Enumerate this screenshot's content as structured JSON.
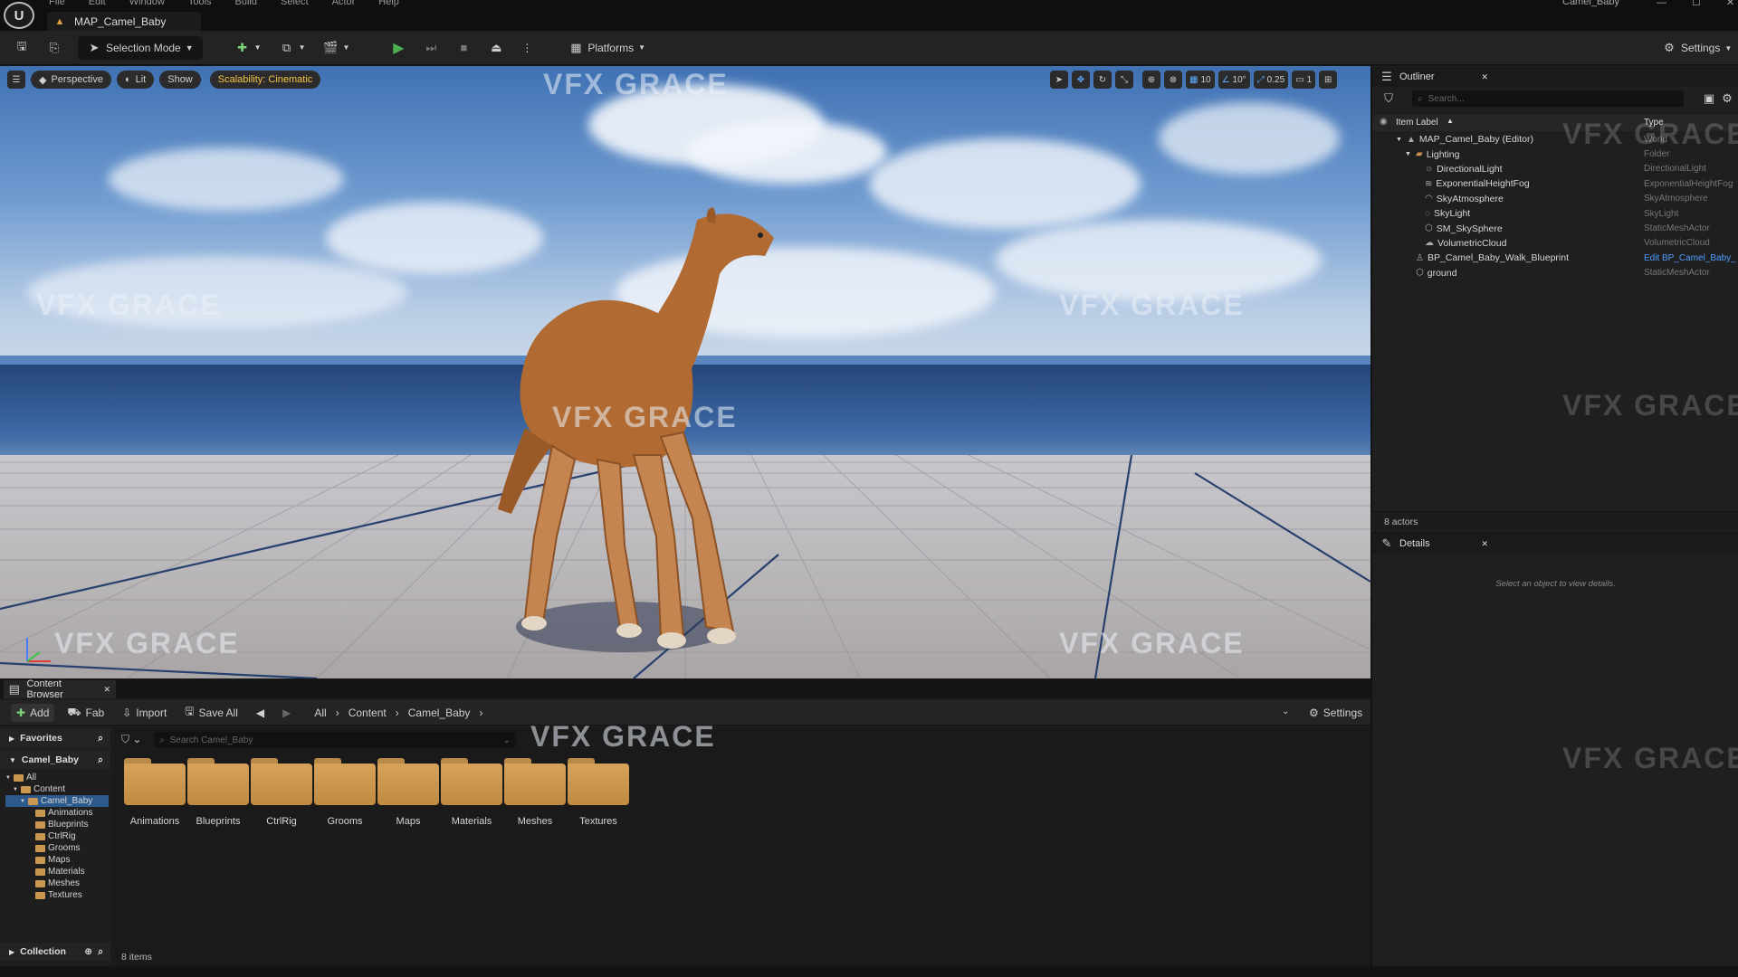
{
  "menubar": {
    "menus": [
      "File",
      "Edit",
      "Window",
      "Tools",
      "Build",
      "Select",
      "Actor",
      "Help"
    ],
    "map_tab": "MAP_Camel_Baby",
    "project": "Camel_Baby"
  },
  "toolbar": {
    "selection_mode": "Selection Mode",
    "platforms": "Platforms",
    "settings": "Settings"
  },
  "viewport": {
    "perspective": "Perspective",
    "lit": "Lit",
    "show": "Show",
    "scalability": "Scalability: Cinematic",
    "grid": "10",
    "angle": "10°",
    "scale": "0.25",
    "camera": "1"
  },
  "watermark": "VFX GRACE",
  "outliner": {
    "tab": "Outliner",
    "search_placeholder": "Search...",
    "col_label": "Item Label",
    "col_type": "Type",
    "rows": [
      {
        "label": "MAP_Camel_Baby (Editor)",
        "type": "World",
        "indent": 0,
        "icon": "map-icon"
      },
      {
        "label": "Lighting",
        "type": "Folder",
        "indent": 1,
        "icon": "folder-icon"
      },
      {
        "label": "DirectionalLight",
        "type": "DirectionalLight",
        "indent": 2,
        "icon": "sun-icon"
      },
      {
        "label": "ExponentialHeightFog",
        "type": "ExponentialHeightFog",
        "indent": 2,
        "icon": "fog-icon"
      },
      {
        "label": "SkyAtmosphere",
        "type": "SkyAtmosphere",
        "indent": 2,
        "icon": "atmosphere-icon"
      },
      {
        "label": "SkyLight",
        "type": "SkyLight",
        "indent": 2,
        "icon": "skylight-icon"
      },
      {
        "label": "SM_SkySphere",
        "type": "StaticMeshActor",
        "indent": 2,
        "icon": "mesh-icon"
      },
      {
        "label": "VolumetricCloud",
        "type": "VolumetricCloud",
        "indent": 2,
        "icon": "cloud-icon"
      },
      {
        "label": "BP_Camel_Baby_Walk_Blueprint",
        "type": "Edit BP_Camel_Baby_",
        "indent": 1,
        "icon": "actor-icon",
        "link": true
      },
      {
        "label": "ground",
        "type": "StaticMeshActor",
        "indent": 1,
        "icon": "mesh-icon"
      }
    ],
    "count": "8 actors"
  },
  "details": {
    "tab": "Details",
    "hint": "Select an object to view details."
  },
  "content_browser": {
    "tab": "Content Browser",
    "add": "Add",
    "fab": "Fab",
    "import": "Import",
    "save_all": "Save All",
    "breadcrumb": [
      "All",
      "Content",
      "Camel_Baby"
    ],
    "settings": "Settings",
    "search_placeholder": "Search Camel_Baby",
    "favorites": "Favorites",
    "project": "Camel_Baby",
    "collection": "Collection",
    "tree": [
      {
        "label": "All",
        "indent": 0
      },
      {
        "label": "Content",
        "indent": 1
      },
      {
        "label": "Camel_Baby",
        "indent": 2,
        "selected": true
      },
      {
        "label": "Animations",
        "indent": 3
      },
      {
        "label": "Blueprints",
        "indent": 3
      },
      {
        "label": "CtrlRig",
        "indent": 3
      },
      {
        "label": "Grooms",
        "indent": 3
      },
      {
        "label": "Maps",
        "indent": 3
      },
      {
        "label": "Materials",
        "indent": 3
      },
      {
        "label": "Meshes",
        "indent": 3
      },
      {
        "label": "Textures",
        "indent": 3
      }
    ],
    "folders": [
      "Animations",
      "Blueprints",
      "CtrlRig",
      "Grooms",
      "Maps",
      "Materials",
      "Meshes",
      "Textures"
    ],
    "items_count": "8 items"
  },
  "colors": {
    "accent": "#3b82f6",
    "folder": "#c8924a",
    "play": "#4caf50",
    "gold": "#f5c542"
  }
}
